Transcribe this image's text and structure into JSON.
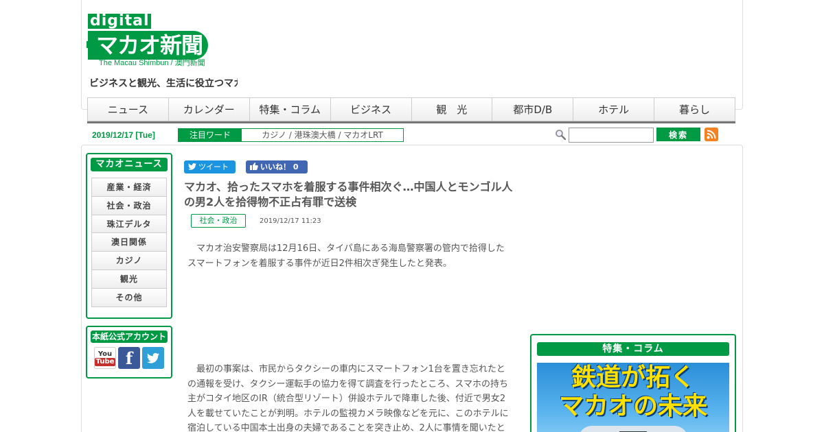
{
  "header": {
    "logo_digital": "digital",
    "logo_main": "マカオ新聞",
    "logo_sub": "The Macau Shimbun / 澳門新聞",
    "tagline": "ビジネスと観光、生活に役立つマカオ"
  },
  "nav": {
    "items": [
      "ニュース",
      "カレンダー",
      "特集・コラム",
      "ビジネス",
      "観　光",
      "都市D/B",
      "ホテル",
      "暮らし"
    ]
  },
  "subbar": {
    "date": "2019/12/17 [Tue]",
    "keyword_label": "注目ワード",
    "keywords": "カジノ / 港珠澳大橋 / マカオLRT",
    "search_placeholder": "",
    "search_button": "検索"
  },
  "sidebar": {
    "news_title": "マカオニュース",
    "categories": [
      "産業・経済",
      "社会・政治",
      "珠江デルタ",
      "澳日関係",
      "カジノ",
      "観光",
      "その他"
    ],
    "accounts_title": "本紙公式アカウント",
    "youtube_you": "You",
    "youtube_tube": "Tube"
  },
  "article": {
    "tweet_label": "ツイート",
    "like_label": "いいね！ 0",
    "title": "マカオ、拾ったスマホを着服する事件相次ぐ…中国人とモンゴル人の男2人を拾得物不正占有罪で送検",
    "category": "社会・政治",
    "timestamp": "2019/12/17 11:23",
    "paragraphs": [
      "マカオ治安警察局は12月16日、タイパ島にある海島警察署の管内で拾得したスマートフォンを着服する事件が近日2件相次ぎ発生したと発表。",
      "最初の事案は、市民からタクシーの車内にスマートフォン1台を置き忘れたとの通報を受け、タクシー運転手の協力を得て調査を行ったところ、スマホの持ち主がコタイ地区のIR（統合型リゾート）併設ホテルで降車した後、付近で男女2人を載せていたことが判明。ホテルの監視カメラ映像などを元に、このホテルに宿泊している中国本土出身の夫婦であることを突き止め、2人に事情を聞いたと"
    ]
  },
  "feature": {
    "title": "特集・コラム",
    "banner_line1": "鉄道が拓く",
    "banner_line2": "マカオの未来"
  },
  "colors": {
    "brand_green": "#009944",
    "rss_orange": "#f58220"
  }
}
